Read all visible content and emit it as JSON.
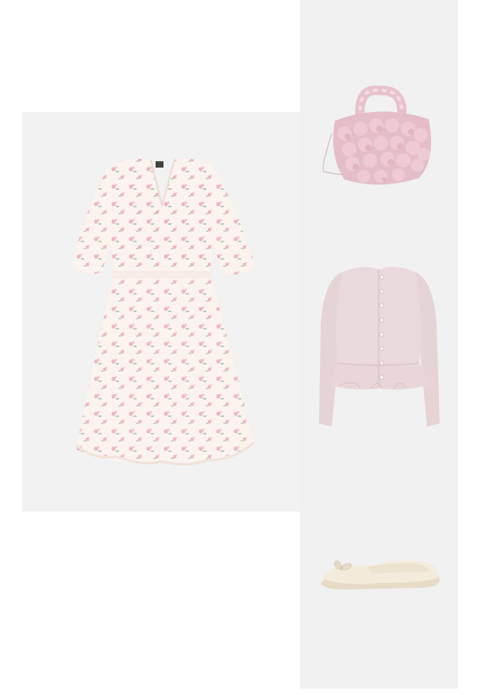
{
  "outfit": {
    "items": [
      {
        "id": "dress",
        "icon": "floral-dress-image"
      },
      {
        "id": "bag",
        "icon": "pink-bobble-handbag-image"
      },
      {
        "id": "cardigan",
        "icon": "pink-peplum-cardigan-image"
      },
      {
        "id": "shoes",
        "icon": "cream-ballet-flat-image"
      }
    ],
    "colors": {
      "tile_background": "#f2f2f2",
      "page_background": "#ffffff",
      "dress_base": "#fbf4ee",
      "floral_pink": "#e9a9c0",
      "floral_green": "#a9c6a6",
      "bag_pink": "#e6c2cc",
      "cardigan_pink": "#ead9dc",
      "shoe_cream": "#f3ecdc"
    }
  }
}
